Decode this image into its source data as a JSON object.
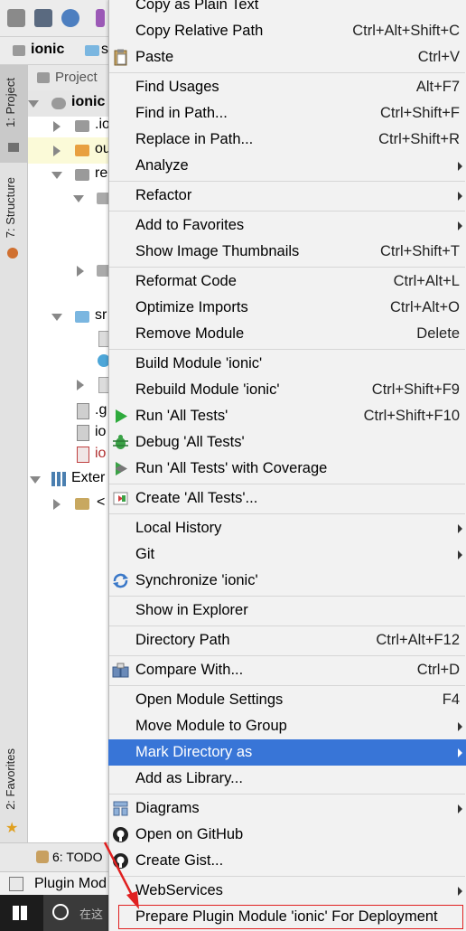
{
  "ide": {
    "nav_root": "ionic",
    "nav_next": "s",
    "project_tab": "Project",
    "left_tabs": {
      "project": "1: Project",
      "structure": "7: Structure",
      "favorites": "2: Favorites"
    },
    "tree": [
      {
        "label": "ionic",
        "kind": "module",
        "expanded": true
      },
      {
        "label": ".io",
        "kind": "folder"
      },
      {
        "label": "ou",
        "kind": "folder-orange"
      },
      {
        "label": "re",
        "kind": "folder",
        "expanded": true
      },
      {
        "label": "sr",
        "kind": "folder",
        "expanded": true
      },
      {
        "label": ".g",
        "kind": "file"
      },
      {
        "label": "io",
        "kind": "file"
      },
      {
        "label": "io",
        "kind": "file-red"
      },
      {
        "label": "Exter",
        "kind": "library"
      },
      {
        "label": "<",
        "kind": "library-item"
      }
    ],
    "todo_tab": "6: TODO",
    "plugin_bar": "Plugin Mod",
    "taskbar_search": "在这"
  },
  "context_menu": {
    "items": [
      {
        "label": "Copy as Plain Text",
        "shortcut": "",
        "submenu": false
      },
      {
        "label": "Copy Relative Path",
        "shortcut": "Ctrl+Alt+Shift+C",
        "submenu": false
      },
      {
        "label": "Paste",
        "shortcut": "Ctrl+V",
        "submenu": false,
        "icon": "paste-icon"
      },
      {
        "label": "Find Usages",
        "shortcut": "Alt+F7",
        "submenu": false
      },
      {
        "label": "Find in Path...",
        "shortcut": "Ctrl+Shift+F",
        "submenu": false
      },
      {
        "label": "Replace in Path...",
        "shortcut": "Ctrl+Shift+R",
        "submenu": false
      },
      {
        "label": "Analyze",
        "shortcut": "",
        "submenu": true
      },
      {
        "label": "Refactor",
        "shortcut": "",
        "submenu": true
      },
      {
        "label": "Add to Favorites",
        "shortcut": "",
        "submenu": true
      },
      {
        "label": "Show Image Thumbnails",
        "shortcut": "Ctrl+Shift+T",
        "submenu": false
      },
      {
        "label": "Reformat Code",
        "shortcut": "Ctrl+Alt+L",
        "submenu": false
      },
      {
        "label": "Optimize Imports",
        "shortcut": "Ctrl+Alt+O",
        "submenu": false
      },
      {
        "label": "Remove Module",
        "shortcut": "Delete",
        "submenu": false
      },
      {
        "label": "Build Module 'ionic'",
        "shortcut": "",
        "submenu": false
      },
      {
        "label": "Rebuild Module 'ionic'",
        "shortcut": "Ctrl+Shift+F9",
        "submenu": false
      },
      {
        "label": "Run 'All Tests'",
        "shortcut": "Ctrl+Shift+F10",
        "submenu": false,
        "icon": "run-icon"
      },
      {
        "label": "Debug 'All Tests'",
        "shortcut": "",
        "submenu": false,
        "icon": "debug-icon"
      },
      {
        "label": "Run 'All Tests' with Coverage",
        "shortcut": "",
        "submenu": false,
        "icon": "coverage-icon"
      },
      {
        "label": "Create 'All Tests'...",
        "shortcut": "",
        "submenu": false,
        "icon": "create-test-icon"
      },
      {
        "label": "Local History",
        "shortcut": "",
        "submenu": true
      },
      {
        "label": "Git",
        "shortcut": "",
        "submenu": true
      },
      {
        "label": "Synchronize 'ionic'",
        "shortcut": "",
        "submenu": false,
        "icon": "sync-icon"
      },
      {
        "label": "Show in Explorer",
        "shortcut": "",
        "submenu": false
      },
      {
        "label": "Directory Path",
        "shortcut": "Ctrl+Alt+F12",
        "submenu": false
      },
      {
        "label": "Compare With...",
        "shortcut": "Ctrl+D",
        "submenu": false,
        "icon": "compare-icon"
      },
      {
        "label": "Open Module Settings",
        "shortcut": "F4",
        "submenu": false
      },
      {
        "label": "Move Module to Group",
        "shortcut": "",
        "submenu": true
      },
      {
        "label": "Mark Directory as",
        "shortcut": "",
        "submenu": true,
        "selected": true
      },
      {
        "label": "Add as Library...",
        "shortcut": "",
        "submenu": false
      },
      {
        "label": "Diagrams",
        "shortcut": "",
        "submenu": true,
        "icon": "diagram-icon"
      },
      {
        "label": "Open on GitHub",
        "shortcut": "",
        "submenu": false,
        "icon": "github-icon"
      },
      {
        "label": "Create Gist...",
        "shortcut": "",
        "submenu": false,
        "icon": "github-icon"
      },
      {
        "label": "WebServices",
        "shortcut": "",
        "submenu": true
      },
      {
        "label": "Prepare Plugin Module 'ionic' For Deployment",
        "shortcut": "",
        "submenu": false,
        "highlighted": true
      }
    ]
  },
  "colors": {
    "selection": "#3875d7",
    "annotation": "#e02020",
    "menu_bg": "#f2f2f2"
  }
}
